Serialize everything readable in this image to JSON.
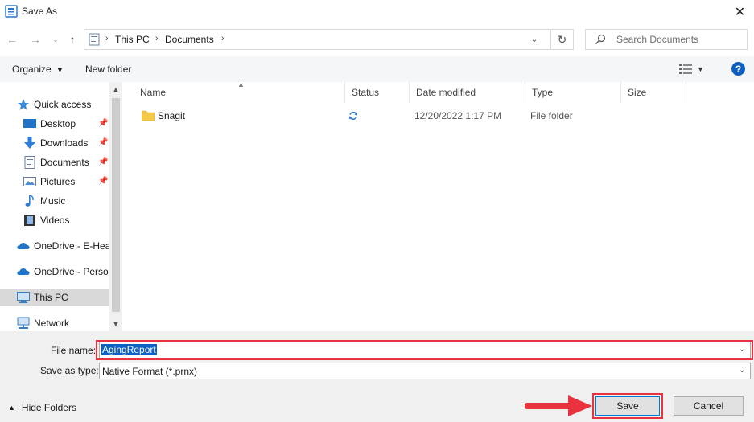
{
  "window": {
    "title": "Save As"
  },
  "address": {
    "crumbs": [
      "This PC",
      "Documents"
    ]
  },
  "search": {
    "placeholder": "Search Documents"
  },
  "toolbar": {
    "organize": "Organize",
    "new_folder": "New folder"
  },
  "nav": {
    "items": [
      {
        "label": "Quick access",
        "icon": "star-icon"
      },
      {
        "label": "Desktop",
        "icon": "desktop-icon",
        "pinned": true
      },
      {
        "label": "Downloads",
        "icon": "download-arrow-icon",
        "pinned": true
      },
      {
        "label": "Documents",
        "icon": "document-icon",
        "pinned": true
      },
      {
        "label": "Pictures",
        "icon": "pictures-icon",
        "pinned": true
      },
      {
        "label": "Music",
        "icon": "music-note-icon"
      },
      {
        "label": "Videos",
        "icon": "film-icon"
      },
      {
        "label": "OneDrive - E-Heal",
        "icon": "cloud-icon"
      },
      {
        "label": "OneDrive - Persor",
        "icon": "cloud-icon"
      },
      {
        "label": "This PC",
        "icon": "computer-icon",
        "selected": true
      },
      {
        "label": "Network",
        "icon": "network-icon"
      }
    ]
  },
  "file_list": {
    "columns": [
      "Name",
      "Status",
      "Date modified",
      "Type",
      "Size"
    ],
    "rows": [
      {
        "name": "Snagit",
        "status": "sync-icon",
        "date_modified": "12/20/2022 1:17 PM",
        "type": "File folder",
        "size": ""
      }
    ]
  },
  "form": {
    "file_name_label": "File name:",
    "file_name_value": "AgingReport",
    "save_as_type_label": "Save as type:",
    "save_as_type_value": "Native Format (*.prnx)"
  },
  "footer": {
    "hide_folders": "Hide Folders",
    "save": "Save",
    "cancel": "Cancel"
  },
  "colors": {
    "accent": "#0078d7",
    "highlight_annotation": "#e8323e",
    "selection": "#0b61c4"
  }
}
